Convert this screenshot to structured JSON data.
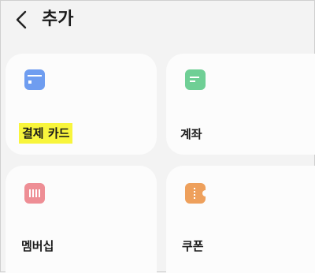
{
  "header": {
    "title": "추가",
    "back_icon": "chevron-left-icon"
  },
  "colors": {
    "background": "#f3f3f3",
    "card": "#fcfcfc",
    "highlight": "#f8f53c",
    "payment_icon": "#6f9df0",
    "account_icon": "#6fcf95",
    "membership_icon": "#ee8e95",
    "coupon_icon": "#eea05c"
  },
  "cards": [
    {
      "label": "결제 카드",
      "icon": "card-icon",
      "highlighted": true
    },
    {
      "label": "계좌",
      "icon": "account-icon",
      "highlighted": false
    },
    {
      "label": "멤버십",
      "icon": "barcode-icon",
      "highlighted": false
    },
    {
      "label": "쿠폰",
      "icon": "ticket-icon",
      "highlighted": false
    }
  ]
}
